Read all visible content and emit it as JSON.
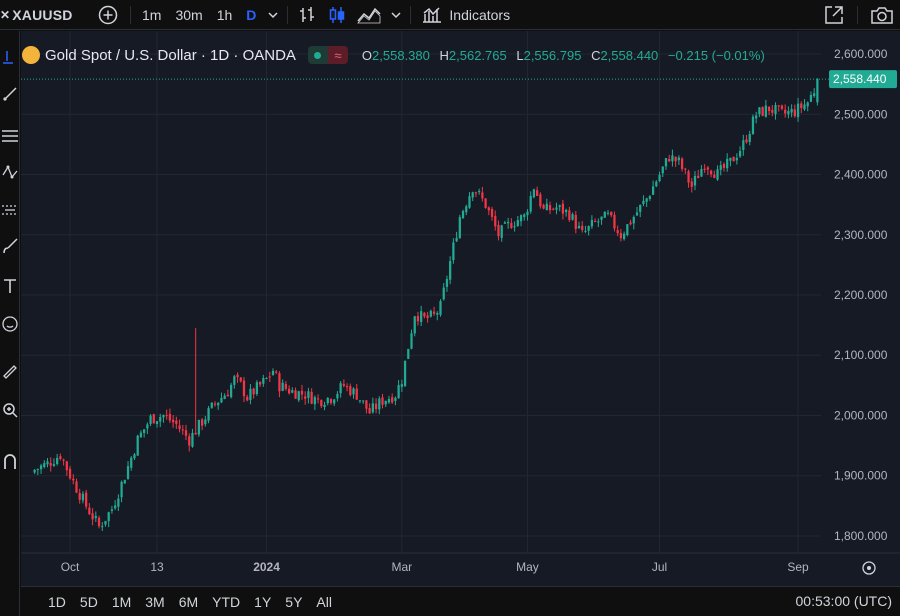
{
  "toolbar": {
    "symbol": "XAUUSD",
    "intervals": [
      "1m",
      "30m",
      "1h",
      "D"
    ],
    "active_interval": "D",
    "indicators_label": "Indicators"
  },
  "legend": {
    "title": "Gold Spot / U.S. Dollar · 1D · OANDA",
    "o_key": "O",
    "o_val": "2,558.380",
    "h_key": "H",
    "h_val": "2,562.765",
    "l_key": "L",
    "l_val": "2,556.795",
    "c_key": "C",
    "c_val": "2,558.440",
    "change": "−0.215 (−0.01%)",
    "up_color": "#22ab94",
    "down_color": "#f23645"
  },
  "price_axis": {
    "ticks": [
      "2,600.000",
      "2,500.000",
      "2,400.000",
      "2,300.000",
      "2,200.000",
      "2,100.000",
      "2,000.000",
      "1,900.000",
      "1,800.000"
    ],
    "last_price_label": "2,558.440"
  },
  "time_axis": {
    "labels": [
      "Oct",
      "13",
      "2024",
      "Mar",
      "May",
      "Jul",
      "Sep"
    ]
  },
  "bottom": {
    "ranges": [
      "1D",
      "5D",
      "1M",
      "3M",
      "6M",
      "YTD",
      "1Y",
      "5Y",
      "All"
    ],
    "clock": "00:53:00 (UTC)"
  },
  "chart_data": {
    "type": "candlestick",
    "ylim": [
      1775,
      2625
    ],
    "last_price": 2558.44,
    "x_ticks": [
      {
        "label": "Oct",
        "index": 11
      },
      {
        "label": "13",
        "index": 38
      },
      {
        "label": "2024",
        "index": 72
      },
      {
        "label": "Mar",
        "index": 114
      },
      {
        "label": "May",
        "index": 153
      },
      {
        "label": "Jul",
        "index": 194
      },
      {
        "label": "Sep",
        "index": 237
      }
    ],
    "path": [
      [
        0,
        1910
      ],
      [
        4,
        1920
      ],
      [
        8,
        1935
      ],
      [
        12,
        1890
      ],
      [
        16,
        1850
      ],
      [
        20,
        1815
      ],
      [
        24,
        1845
      ],
      [
        28,
        1900
      ],
      [
        32,
        1960
      ],
      [
        36,
        1995
      ],
      [
        40,
        2000
      ],
      [
        44,
        1985
      ],
      [
        48,
        1960
      ],
      [
        52,
        1990
      ],
      [
        56,
        2020
      ],
      [
        60,
        2040
      ],
      [
        62,
        2060
      ],
      [
        64,
        2050
      ],
      [
        66,
        2030
      ],
      [
        68,
        2040
      ],
      [
        72,
        2060
      ],
      [
        74,
        2075
      ],
      [
        76,
        2050
      ],
      [
        80,
        2040
      ],
      [
        84,
        2035
      ],
      [
        88,
        2025
      ],
      [
        92,
        2030
      ],
      [
        96,
        2050
      ],
      [
        100,
        2035
      ],
      [
        104,
        2005
      ],
      [
        108,
        2025
      ],
      [
        112,
        2035
      ],
      [
        114,
        2060
      ],
      [
        118,
        2170
      ],
      [
        121,
        2160
      ],
      [
        124,
        2165
      ],
      [
        126,
        2180
      ],
      [
        128,
        2230
      ],
      [
        132,
        2330
      ],
      [
        136,
        2380
      ],
      [
        140,
        2350
      ],
      [
        144,
        2300
      ],
      [
        148,
        2320
      ],
      [
        152,
        2330
      ],
      [
        155,
        2380
      ],
      [
        158,
        2340
      ],
      [
        162,
        2345
      ],
      [
        166,
        2335
      ],
      [
        170,
        2300
      ],
      [
        174,
        2320
      ],
      [
        178,
        2330
      ],
      [
        182,
        2300
      ],
      [
        186,
        2330
      ],
      [
        190,
        2360
      ],
      [
        194,
        2400
      ],
      [
        197,
        2430
      ],
      [
        200,
        2420
      ],
      [
        204,
        2380
      ],
      [
        208,
        2420
      ],
      [
        212,
        2400
      ],
      [
        216,
        2420
      ],
      [
        220,
        2450
      ],
      [
        224,
        2500
      ],
      [
        228,
        2510
      ],
      [
        232,
        2500
      ],
      [
        236,
        2505
      ],
      [
        240,
        2520
      ],
      [
        242,
        2540
      ],
      [
        243,
        2558
      ]
    ],
    "spike_index": 50,
    "spike_high": 2145
  }
}
